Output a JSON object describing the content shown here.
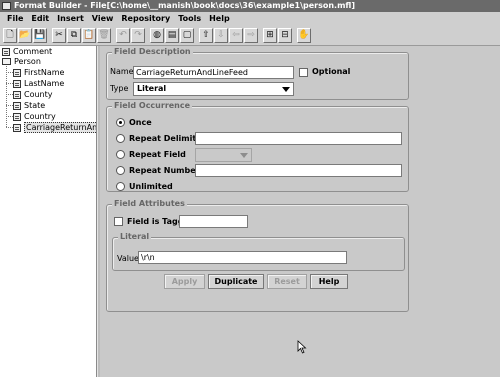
{
  "window": {
    "title": "Format Builder - File[C:\\home\\__manish\\book\\docs\\36\\example1\\person.mfl]"
  },
  "menu": [
    "File",
    "Edit",
    "Insert",
    "View",
    "Repository",
    "Tools",
    "Help"
  ],
  "toolbar": {
    "buttons": [
      {
        "name": "new-icon",
        "glyph": "🗋",
        "disabled": false
      },
      {
        "name": "open-icon",
        "glyph": "📂",
        "disabled": false
      },
      {
        "name": "save-icon",
        "glyph": "💾",
        "disabled": false
      },
      {
        "name": "cut-icon",
        "glyph": "✂",
        "disabled": false
      },
      {
        "name": "copy-icon",
        "glyph": "⧉",
        "disabled": false
      },
      {
        "name": "paste-icon",
        "glyph": "📋",
        "disabled": true
      },
      {
        "name": "delete-icon",
        "glyph": "🗑",
        "disabled": true
      },
      {
        "name": "undo-icon",
        "glyph": "↶",
        "disabled": true
      },
      {
        "name": "redo-icon",
        "glyph": "↷",
        "disabled": true
      },
      {
        "name": "insert-field-icon",
        "glyph": "◍",
        "disabled": false
      },
      {
        "name": "insert-group-icon",
        "glyph": "▤",
        "disabled": false
      },
      {
        "name": "insert-comment-icon",
        "glyph": "▢",
        "disabled": false
      },
      {
        "name": "move-up-icon",
        "glyph": "⇧",
        "disabled": false
      },
      {
        "name": "move-down-icon",
        "glyph": "⇩",
        "disabled": true
      },
      {
        "name": "move-left-icon",
        "glyph": "⇦",
        "disabled": true
      },
      {
        "name": "move-right-icon",
        "glyph": "⇨",
        "disabled": true
      },
      {
        "name": "expand-icon",
        "glyph": "⊞",
        "disabled": false
      },
      {
        "name": "collapse-icon",
        "glyph": "⊟",
        "disabled": false
      },
      {
        "name": "help-icon",
        "glyph": "✋",
        "disabled": false
      }
    ]
  },
  "tree": {
    "comment": "Comment",
    "root": "Person",
    "children": [
      "FirstName",
      "LastName",
      "County",
      "State",
      "Country",
      "CarriageReturnAnd"
    ]
  },
  "field_description": {
    "legend": "Field Description",
    "name_label": "Name",
    "name_value": "CarriageReturnAndLineFeed",
    "optional_label": "Optional",
    "type_label": "Type",
    "type_value": "Literal"
  },
  "occurrence": {
    "legend": "Field Occurrence",
    "once": "Once",
    "repeat_delimiter": "Repeat Delimiter",
    "repeat_field": "Repeat Field",
    "repeat_number": "Repeat Number",
    "unlimited": "Unlimited"
  },
  "attributes": {
    "legend": "Field Attributes",
    "tagged_label": "Field is Tagged",
    "literal_legend": "Literal",
    "value_label": "Value",
    "value": "\\r\\n"
  },
  "actions": {
    "apply": "Apply",
    "duplicate": "Duplicate",
    "reset": "Reset",
    "help": "Help"
  }
}
